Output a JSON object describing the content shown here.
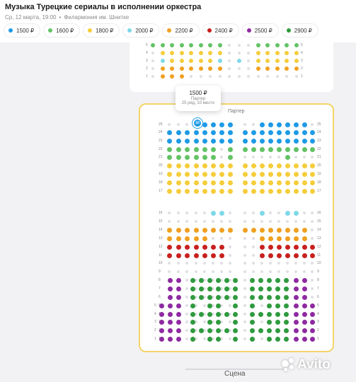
{
  "event": {
    "title": "Музыка Турецкие сериалы в исполнении оркестра",
    "date": "Ср, 12 марта, 19:00",
    "separator": "•",
    "venue": "Филармония им. Шнитке"
  },
  "prices": [
    {
      "label": "1500 ₽",
      "color": "#1e9ae6"
    },
    {
      "label": "1600 ₽",
      "color": "#63c265"
    },
    {
      "label": "1800 ₽",
      "color": "#f5cd3b"
    },
    {
      "label": "2000 ₽",
      "color": "#7fd8e8"
    },
    {
      "label": "2200 ₽",
      "color": "#f0a020"
    },
    {
      "label": "2400 ₽",
      "color": "#c8201e"
    },
    {
      "label": "2500 ₽",
      "color": "#8e2aa0"
    },
    {
      "label": "2900 ₽",
      "color": "#2f9a3e"
    }
  ],
  "upper_rows": [
    "5",
    "4",
    "3",
    "2",
    "1"
  ],
  "tooltip": {
    "price": "1500 ₽",
    "zone": "Партер",
    "place": "25 ряд, 10 место"
  },
  "selected_seat": "10",
  "parter_label": "Партер",
  "parter_rows": [
    "25",
    "24",
    "23",
    "22",
    "21",
    "20",
    "19",
    "18",
    "17",
    "16",
    "15",
    "14",
    "13",
    "12",
    "11",
    "10",
    "9",
    "8",
    "7",
    "6",
    "5",
    "4",
    "3",
    "2",
    "1"
  ],
  "scene": "Сцена",
  "watermark": "Avito"
}
